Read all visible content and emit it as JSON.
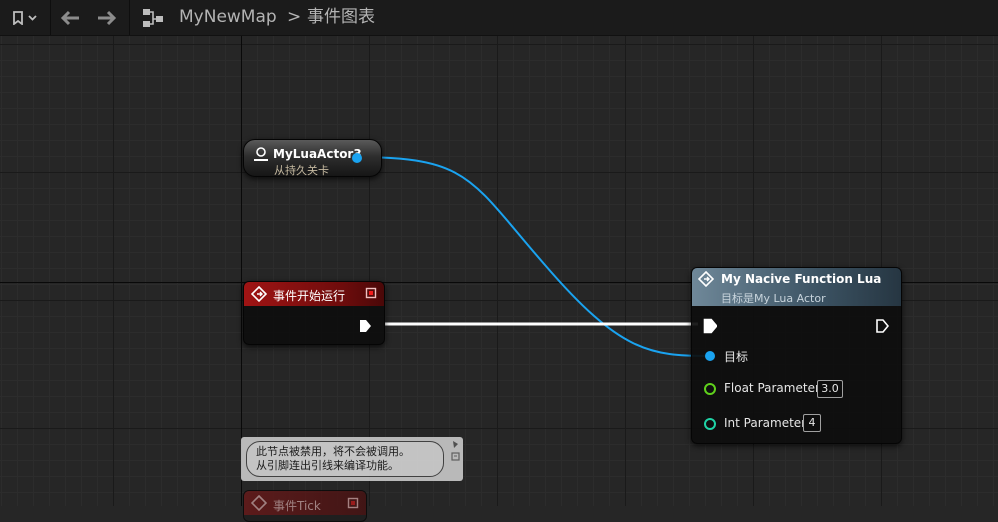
{
  "toolbar": {
    "breadcrumb": {
      "map": "MyNewMap",
      "separator": ">",
      "graph": "事件图表"
    }
  },
  "nodes": {
    "variable": {
      "title": "MyLuaActor3",
      "subtitle": "从持久关卡"
    },
    "begin_play": {
      "title": "事件开始运行"
    },
    "function": {
      "title": "My Nacive Function Lua",
      "subtitle": "目标是My Lua Actor",
      "target_label": "目标",
      "float_label": "Float Parameter",
      "float_value": "3.0",
      "int_label": "Int Parameter",
      "int_value": "4"
    },
    "tick": {
      "title": "事件Tick"
    }
  },
  "comment": {
    "line1": "此节点被禁用，将不会被调用。",
    "line2": "从引脚连出引线来编译功能。"
  },
  "colors": {
    "object_pin": "#1aa3f0",
    "float_pin": "#5fd01c",
    "int_pin": "#1fd3a6",
    "event_header": "#a01414",
    "function_header": "#6f8899",
    "exec_wire": "#ffffff"
  }
}
